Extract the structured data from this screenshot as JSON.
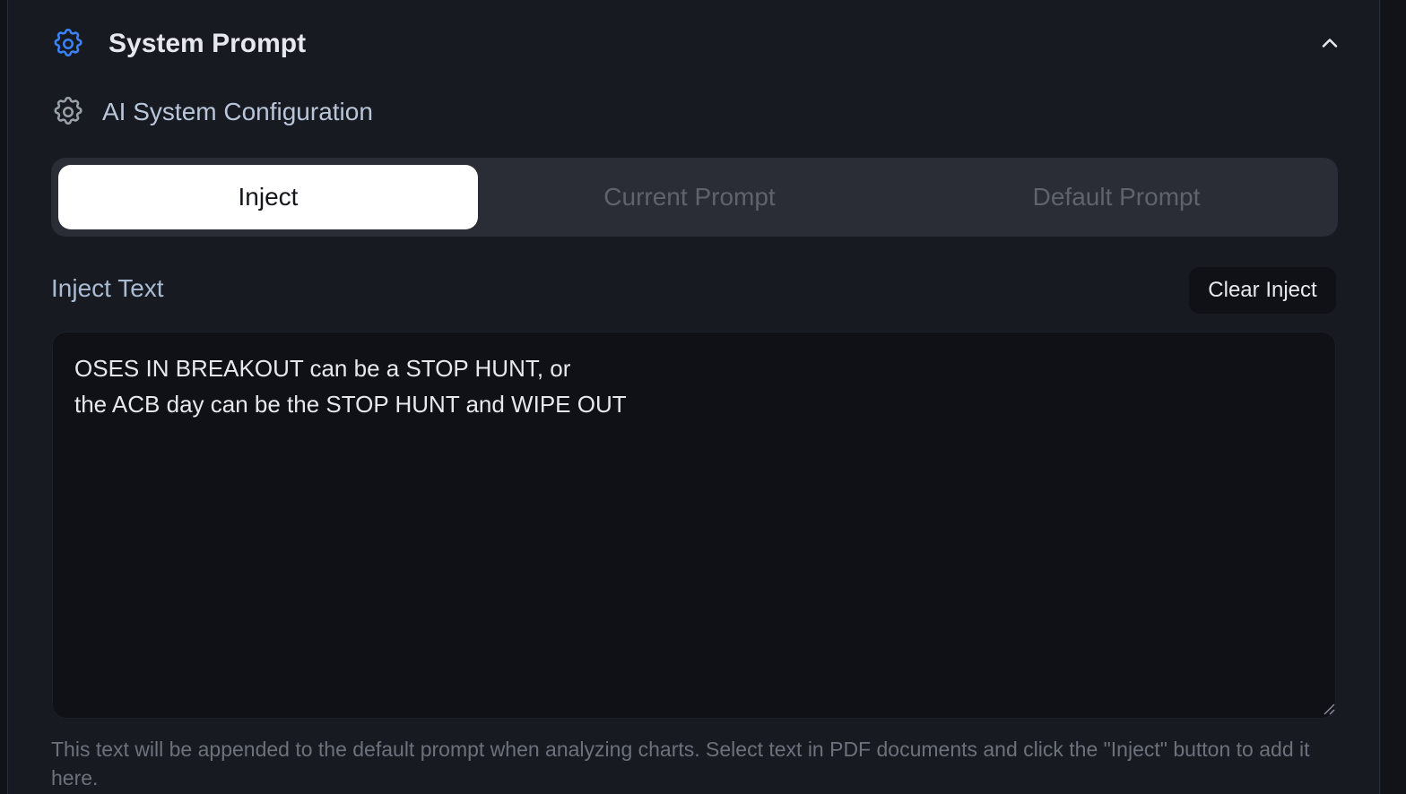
{
  "header": {
    "title": "System Prompt",
    "icon": "gear-icon",
    "collapse_icon": "chevron-up-icon",
    "accent": "#3b82f6"
  },
  "subheader": {
    "label": "AI System Configuration",
    "icon": "gear-icon"
  },
  "tabs": [
    {
      "label": "Inject",
      "active": true
    },
    {
      "label": "Current Prompt",
      "active": false
    },
    {
      "label": "Default Prompt",
      "active": false
    }
  ],
  "inject": {
    "label": "Inject Text",
    "clear_label": "Clear Inject",
    "value": "OSES IN BREAKOUT can be a STOP HUNT, or\nthe ACB day can be the STOP HUNT and WIPE OUT",
    "help": "This text will be appended to the default prompt when analyzing charts. Select text in PDF documents and click the \"Inject\" button to add it here."
  }
}
